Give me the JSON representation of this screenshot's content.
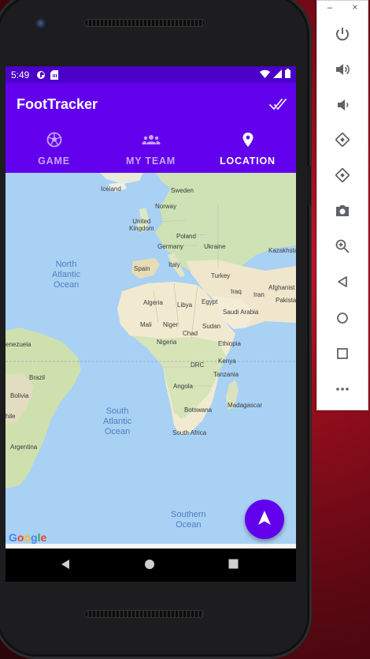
{
  "status_bar": {
    "time": "5:49",
    "icons": [
      "data-saver-icon",
      "sim-card-icon",
      "wifi-icon",
      "cell-signal-icon",
      "battery-icon"
    ]
  },
  "app_bar": {
    "title": "FootTracker",
    "action_icon": "done-all-icon",
    "tabs": [
      {
        "label": "GAME",
        "icon": "soccer-ball-icon",
        "selected": false
      },
      {
        "label": "MY TEAM",
        "icon": "group-icon",
        "selected": false
      },
      {
        "label": "LOCATION",
        "icon": "location-pin-icon",
        "selected": true
      }
    ]
  },
  "map": {
    "countries": [
      {
        "name": "Iceland"
      },
      {
        "name": "Sweden"
      },
      {
        "name": "Norway"
      },
      {
        "name": "United\nKingdom"
      },
      {
        "name": "Poland"
      },
      {
        "name": "Germany"
      },
      {
        "name": "Ukraine"
      },
      {
        "name": "Kazakhsta"
      },
      {
        "name": "Spain"
      },
      {
        "name": "Italy"
      },
      {
        "name": "Turkey"
      },
      {
        "name": "Iraq"
      },
      {
        "name": "Iran"
      },
      {
        "name": "Afghanist"
      },
      {
        "name": "Pakista"
      },
      {
        "name": "Algeria"
      },
      {
        "name": "Libya"
      },
      {
        "name": "Egypt"
      },
      {
        "name": "Saudi Arabia"
      },
      {
        "name": "Mali"
      },
      {
        "name": "Niger"
      },
      {
        "name": "Chad"
      },
      {
        "name": "Sudan"
      },
      {
        "name": "Nigeria"
      },
      {
        "name": "Ethiopia"
      },
      {
        "name": "enezuela"
      },
      {
        "name": "Kenya"
      },
      {
        "name": "DRC"
      },
      {
        "name": "Brazil"
      },
      {
        "name": "Tanzania"
      },
      {
        "name": "Angola"
      },
      {
        "name": "Bolivia"
      },
      {
        "name": "hile"
      },
      {
        "name": "Madagascar"
      },
      {
        "name": "Botswana"
      },
      {
        "name": "South Africa"
      },
      {
        "name": "Argentina"
      }
    ],
    "oceans": [
      {
        "name": "North\nAtlantic\nOcean"
      },
      {
        "name": "South\nAtlantic\nOcean"
      },
      {
        "name": "Southern\nOcean"
      }
    ],
    "attribution": "Google",
    "fab_icon": "navigation-arrow-icon"
  },
  "nav_bar": {
    "back": "back-icon",
    "home": "home-icon",
    "recents": "recents-icon"
  },
  "emulator_toolbar": {
    "buttons": [
      "power-icon",
      "volume-up-icon",
      "volume-down-icon",
      "rotate-left-icon",
      "rotate-right-icon",
      "camera-icon",
      "zoom-icon",
      "back-icon",
      "home-icon",
      "overview-icon",
      "more-icon"
    ]
  },
  "colors": {
    "primary": "#6200ee",
    "status_bar": "#4a00c9",
    "tab_inactive": "#c6a5f6",
    "map_water": "#a9d1f4"
  }
}
